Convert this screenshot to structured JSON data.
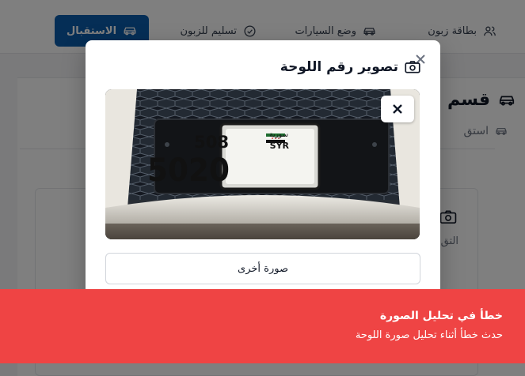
{
  "nav": {
    "customer_card": "بطاقة زبون",
    "car_status": "وضع السيارات",
    "delivery": "تسليم للزبون",
    "reception": "الاستقبال",
    "icons": {
      "customer_card": "users-icon",
      "car_status": "car-icon",
      "delivery": "check-circle-icon",
      "reception": "car-icon"
    }
  },
  "page": {
    "title": "قسم",
    "subtitle": "استق",
    "inner_label": "التق",
    "icons": {
      "title": "car-icon",
      "subtitle": "car-icon",
      "inner": "camera-icon"
    }
  },
  "modal": {
    "title": "تصوير رقم اللوحة",
    "title_icon": "camera-icon",
    "close_icon": "close-icon",
    "remove_photo_icon": "close-icon",
    "another_photo_button": "صورة أخرى",
    "photo": {
      "plate_top_number": "508",
      "plate_country_code": "SYR",
      "plate_country_name": "سورية",
      "plate_number": "5020"
    }
  },
  "toast": {
    "title": "خطأ في تحليل الصورة",
    "description": "حدث خطأ أثناء تحليل صورة اللوحة",
    "color": "#ef4444"
  },
  "colors": {
    "primary": "#0b5cad",
    "error": "#ef4444"
  }
}
